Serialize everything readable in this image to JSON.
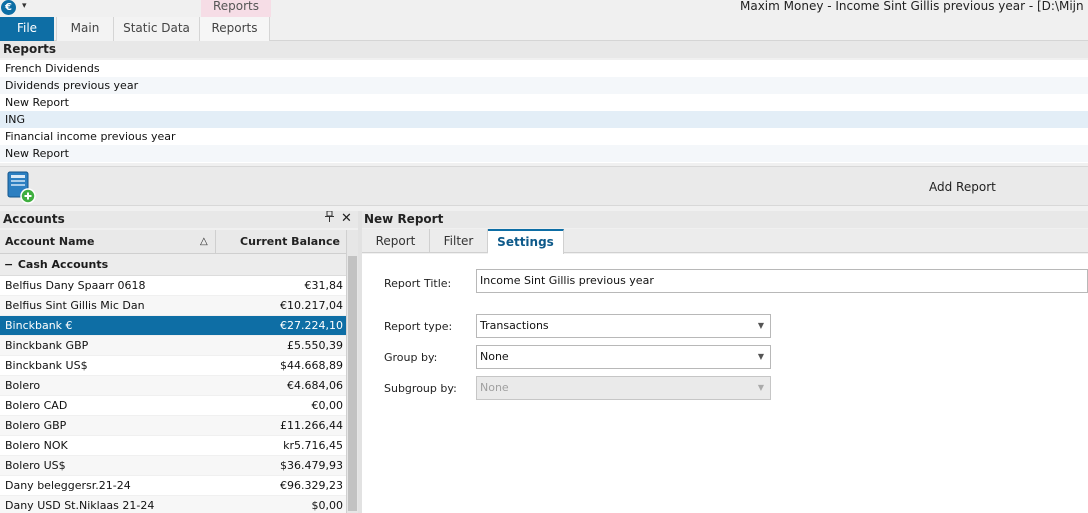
{
  "titlebar": {
    "logo_glyph": "€",
    "qat_glyph": "▾",
    "context_tab_label": "Reports",
    "window_title": "Maxim Money - Income Sint Gillis previous year - [D:\\Mijn Docume"
  },
  "ribbon": {
    "tabs": [
      {
        "label": "File"
      },
      {
        "label": "Main"
      },
      {
        "label": "Static Data"
      },
      {
        "label": "Reports"
      }
    ]
  },
  "reports": {
    "header": "Reports",
    "items": [
      {
        "label": "French Dividends"
      },
      {
        "label": "Dividends previous year"
      },
      {
        "label": "New Report"
      },
      {
        "label": "ING"
      },
      {
        "label": "Financial income previous year"
      },
      {
        "label": "New Report"
      }
    ],
    "add_report_label": "Add Report"
  },
  "accounts": {
    "header": "Accounts",
    "pin_glyph": "📌",
    "close_glyph": "✕",
    "columns": {
      "name": "Account Name",
      "balance": "Current Balance"
    },
    "sort_glyph": "△",
    "group": {
      "collapse_glyph": "−",
      "label": "Cash Accounts"
    },
    "rows": [
      {
        "name": "Belfius Dany Spaarr 0618",
        "balance": "€31,84"
      },
      {
        "name": "Belfius Sint Gillis Mic Dan",
        "balance": "€10.217,04"
      },
      {
        "name": "Binckbank €",
        "balance": "€27.224,10"
      },
      {
        "name": "Binckbank GBP",
        "balance": "£5.550,39"
      },
      {
        "name": "Binckbank US$",
        "balance": "$44.668,89"
      },
      {
        "name": "Bolero",
        "balance": "€4.684,06"
      },
      {
        "name": "Bolero CAD",
        "balance": "€0,00"
      },
      {
        "name": "Bolero GBP",
        "balance": "£11.266,44"
      },
      {
        "name": "Bolero NOK",
        "balance": "kr5.716,45"
      },
      {
        "name": "Bolero US$",
        "balance": "$36.479,93"
      },
      {
        "name": "Dany  beleggersr.21-24",
        "balance": "€96.329,23"
      },
      {
        "name": "Dany  USD St.Niklaas 21-24",
        "balance": "$0,00"
      }
    ]
  },
  "new_report": {
    "header": "New Report",
    "tabs": [
      {
        "label": "Report"
      },
      {
        "label": "Filter"
      },
      {
        "label": "Settings"
      }
    ],
    "settings": {
      "report_title_label": "Report Title:",
      "report_title_value": "Income Sint Gillis previous year",
      "report_type_label": "Report type:",
      "report_type_value": "Transactions",
      "group_by_label": "Group by:",
      "group_by_value": "None",
      "subgroup_by_label": "Subgroup by:",
      "subgroup_by_value": "None",
      "combo_arrow_glyph": "▼"
    }
  },
  "colors": {
    "accent": "#0e6ea5",
    "context_tab": "#f6dde6",
    "selection": "#0e6ea5"
  }
}
